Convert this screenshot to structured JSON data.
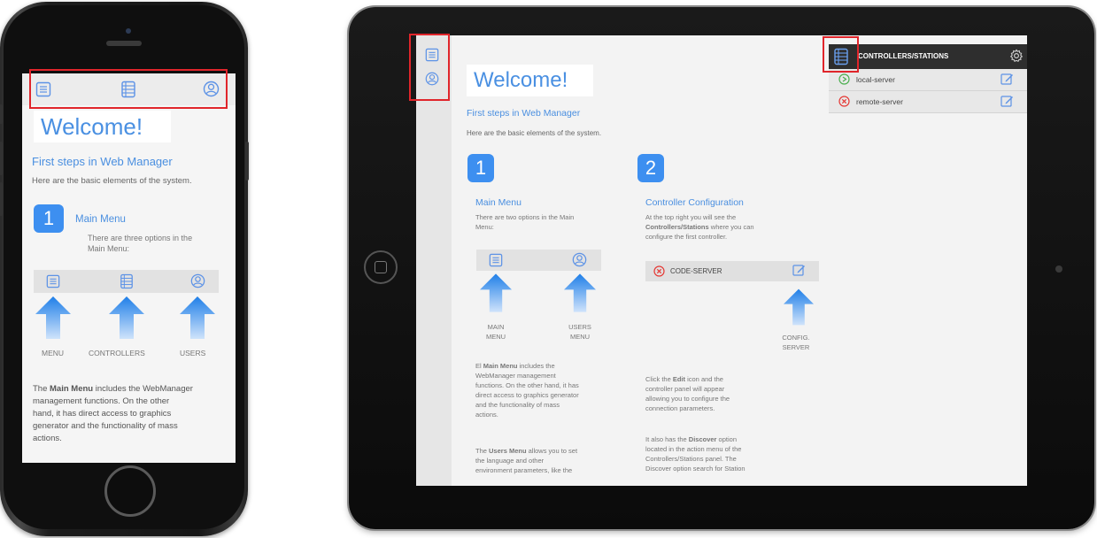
{
  "phone": {
    "welcome": "Welcome!",
    "subtitle": "First steps in Web Manager",
    "intro": "Here are the basic elements of the system.",
    "step_number": "1",
    "step_title": "Main Menu",
    "step_desc_1": "There are three options in the",
    "step_desc_2": "Main Menu:",
    "labels": [
      "MENU",
      "CONTROLLERS",
      "USERS"
    ],
    "body_line_1_pre": "The ",
    "body_line_1_bold": "Main Menu",
    "body_line_1_post": " includes the WebManager",
    "body_lines": [
      "management functions. On the other",
      "hand, it has direct access to graphics",
      "generator and the functionality of mass",
      "actions."
    ]
  },
  "tablet": {
    "welcome": "Welcome!",
    "subtitle": "First steps in Web Manager",
    "intro": "Here are the basic elements of the system.",
    "panel": {
      "title": "CONTROLLERS/STATIONS",
      "servers": [
        {
          "name": "local-server",
          "status": "ok"
        },
        {
          "name": "remote-server",
          "status": "error"
        }
      ]
    },
    "step1": {
      "number": "1",
      "title": "Main Menu",
      "desc": [
        "There are two options in the Main",
        "Menu:"
      ],
      "label_main": [
        "MAIN",
        "MENU"
      ],
      "label_users": [
        "USERS",
        "MENU"
      ],
      "p1": [
        "El ",
        "Main Menu",
        " includes the"
      ],
      "p1_lines": [
        "WebManager management",
        "functions. On the other hand, it has",
        "direct access to graphics generator",
        "and the functionality of mass",
        "actions."
      ],
      "p2": [
        "The ",
        "Users Menu",
        " allows you to set"
      ],
      "p2_lines": [
        "the language and other",
        "environment parameters, like the"
      ]
    },
    "step2": {
      "number": "2",
      "title": "Controller Configuration",
      "desc_1": "At the top right you will see the",
      "desc_2_bold": "Controllers/Stations",
      "desc_2_post": " where you can",
      "desc_3": "configure the first controller.",
      "code_server": "CODE-SERVER",
      "config_label": [
        "CONFIG.",
        "SERVER"
      ],
      "p1": [
        "Click the ",
        "Edit",
        " icon and the"
      ],
      "p1_lines": [
        "controller panel will appear",
        "allowing you to configure the",
        "connection parameters."
      ],
      "p2": [
        "It also has the ",
        "Discover",
        " option"
      ],
      "p2_lines": [
        "located in the action menu of the",
        "Controllers/Stations panel. The",
        "Discover option search for Station"
      ]
    }
  },
  "colors": {
    "accent": "#3d8ff0",
    "highlight": "#e0252b",
    "ok": "#4caf50",
    "error": "#e53935"
  }
}
